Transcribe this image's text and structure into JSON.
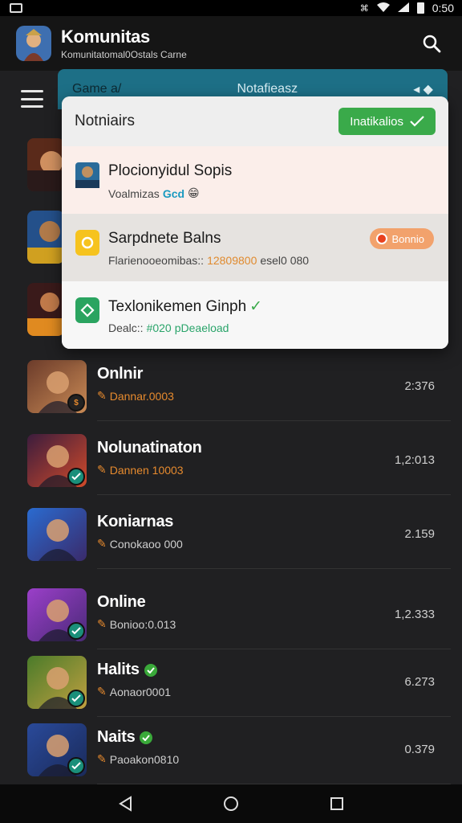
{
  "status_bar": {
    "time": "0:50"
  },
  "app": {
    "title": "Komunitas",
    "subtitle": "Komunitatomal0Ostals Carne"
  },
  "dropdown": {
    "tab_left": "Game a/",
    "tab_center": "Notafieasz",
    "header": "Notniairs",
    "action_button": "Inatikalios",
    "items": [
      {
        "title": "Plocionyidul Sopis",
        "subtitle_a": "Voalmizas",
        "subtitle_b": "Gcd",
        "icon": "game-thumb-icon",
        "bg": "#fbeeea"
      },
      {
        "title": "Sarpdnete Balns",
        "subtitle_a": "Flarienooeomibas::",
        "subtitle_b": "12809800",
        "subtitle_c": "esel0 080",
        "badge": "Bonnio",
        "icon": "sun-icon",
        "bg": "#e6e3e0"
      },
      {
        "title": "Texlonikemen Ginph",
        "subtitle_a": "Dealc::",
        "subtitle_b": "#020",
        "subtitle_c": "pDeaeload",
        "icon": "shield-check-icon",
        "bg": "#f7f7f7"
      }
    ]
  },
  "list": [
    {
      "title": "Onlnir",
      "meta": "Dannar.0003",
      "count": "2:376",
      "meta_color": "#e68a2e",
      "badge": "coin",
      "thumb": [
        "#6b3b2a",
        "#c98a55"
      ]
    },
    {
      "title": "Nolunatinaton",
      "meta": "Dannen 10003",
      "count": "1,2:013",
      "meta_color": "#e68a2e",
      "badge": "teal",
      "thumb": [
        "#3b1c3d",
        "#d04a2a"
      ]
    },
    {
      "title": "Koniarnas",
      "meta": "Conokaoo 000",
      "count": "2.159",
      "meta_color": "#cfcfcf",
      "badge": "none",
      "thumb": [
        "#2a6bd0",
        "#3a2a6a"
      ]
    },
    {
      "title": "Online",
      "meta": "Bonioo:0.013",
      "count": "1,2.333",
      "meta_color": "#cfcfcf",
      "badge": "teal",
      "thumb": [
        "#9b3fc9",
        "#4a2a78"
      ]
    },
    {
      "title": "Halits",
      "meta": "Aonaor0001",
      "count": "6.273",
      "meta_color": "#cfcfcf",
      "badge": "teal",
      "verified": true,
      "thumb": [
        "#4a7b2a",
        "#c0a040"
      ]
    },
    {
      "title": "Naits",
      "meta": "Paoakon0810",
      "count": "0.379",
      "meta_color": "#cfcfcf",
      "badge": "teal",
      "verified": true,
      "thumb": [
        "#2a4a9a",
        "#1a2a5a"
      ]
    }
  ],
  "colors": {
    "accent_green": "#3aaa4a",
    "accent_orange": "#e68a2e",
    "teal": "#1d6f86"
  }
}
